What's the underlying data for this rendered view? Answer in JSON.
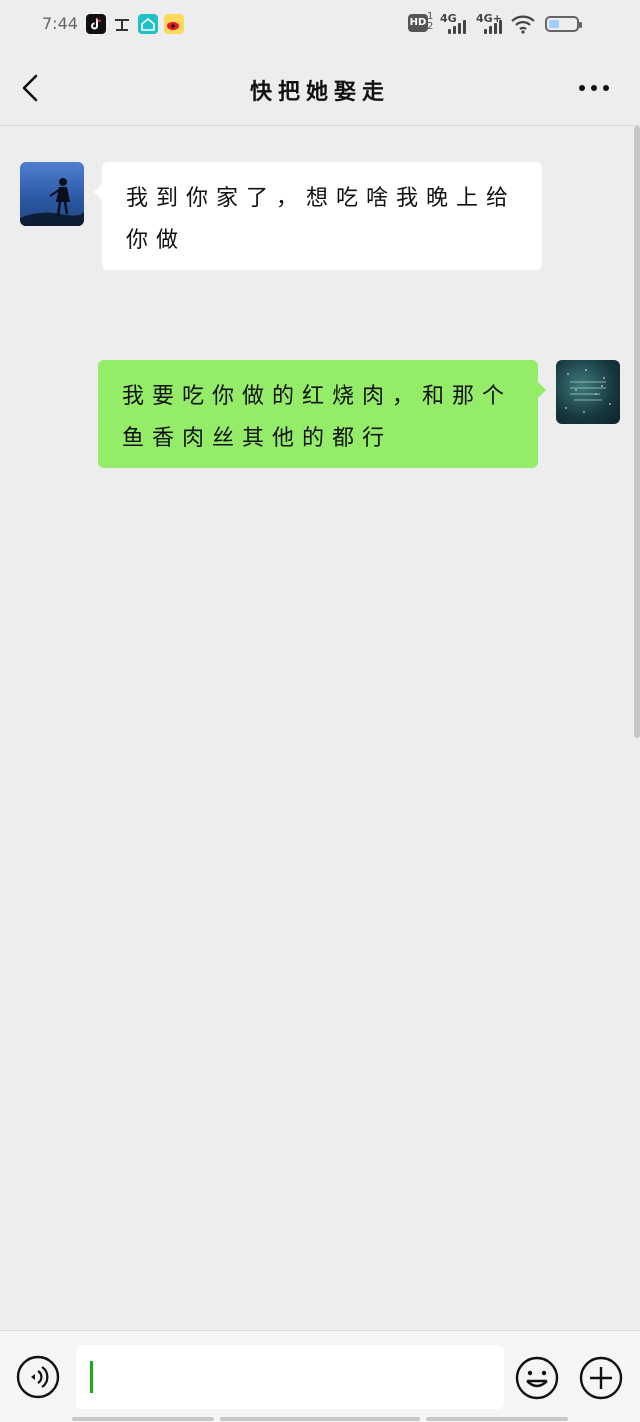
{
  "status_bar": {
    "time": "7:44",
    "hd_label": "HD",
    "sim_number": "1\n2",
    "network_1": "4G",
    "network_2": "4G+",
    "icons": [
      "douyin-icon",
      "notification-app-icon",
      "smart-home-icon",
      "weibo-icon",
      "wifi-icon",
      "battery-icon"
    ],
    "battery_level": 0.4
  },
  "header": {
    "title": "快把她娶走",
    "back_icon": "chevron-left-icon",
    "more_icon": "more-dots-icon"
  },
  "messages": [
    {
      "sender": "other",
      "text": "我到你家了，想吃啥我晚上给你做"
    },
    {
      "sender": "me",
      "text": "我要吃你做的红烧肉，和那个鱼香肉丝其他的都行"
    }
  ],
  "input_bar": {
    "voice_icon": "voice-icon",
    "emoji_icon": "emoji-icon",
    "add_icon": "add-icon",
    "message_value": ""
  },
  "colors": {
    "background": "#ededed",
    "sent_bubble": "#95ec69",
    "received_bubble": "#ffffff",
    "cursor": "#1aad19"
  }
}
